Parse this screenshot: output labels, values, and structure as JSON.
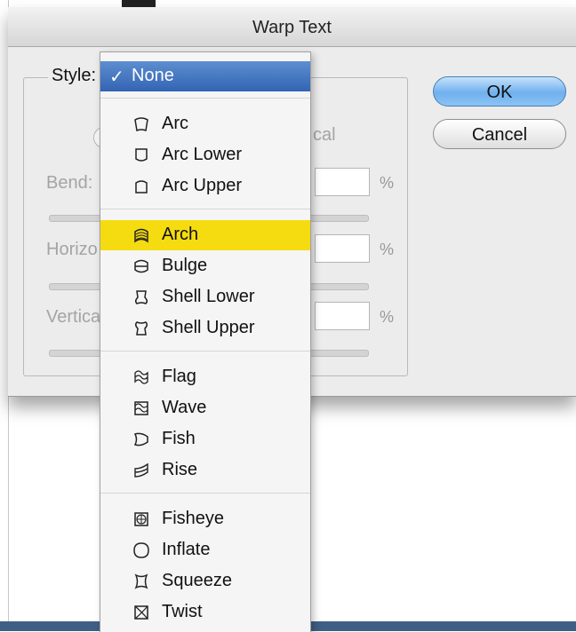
{
  "dialog": {
    "title": "Warp Text",
    "style_label": "Style:",
    "ghost": {
      "orientation_fragment": "cal",
      "bend_label": "Bend:",
      "horizontal_label": "Horizo",
      "vertical_label": "Vertica",
      "percent": "%"
    },
    "buttons": {
      "ok": "OK",
      "cancel": "Cancel"
    }
  },
  "menu": {
    "selected": {
      "check": "✓",
      "label": "None"
    },
    "items": [
      {
        "label": "Arc",
        "icon": "arc-icon"
      },
      {
        "label": "Arc Lower",
        "icon": "arc-lower-icon"
      },
      {
        "label": "Arc Upper",
        "icon": "arc-upper-icon"
      },
      {
        "label": "Arch",
        "icon": "arch-icon",
        "highlighted": true
      },
      {
        "label": "Bulge",
        "icon": "bulge-icon"
      },
      {
        "label": "Shell Lower",
        "icon": "shell-lower-icon"
      },
      {
        "label": "Shell Upper",
        "icon": "shell-upper-icon"
      },
      {
        "label": "Flag",
        "icon": "flag-icon"
      },
      {
        "label": "Wave",
        "icon": "wave-icon"
      },
      {
        "label": "Fish",
        "icon": "fish-icon"
      },
      {
        "label": "Rise",
        "icon": "rise-icon"
      },
      {
        "label": "Fisheye",
        "icon": "fisheye-icon"
      },
      {
        "label": "Inflate",
        "icon": "inflate-icon"
      },
      {
        "label": "Squeeze",
        "icon": "squeeze-icon"
      },
      {
        "label": "Twist",
        "icon": "twist-icon"
      }
    ],
    "colors": {
      "highlight": "#f5dc10",
      "selected": "#3a6cbc"
    }
  }
}
